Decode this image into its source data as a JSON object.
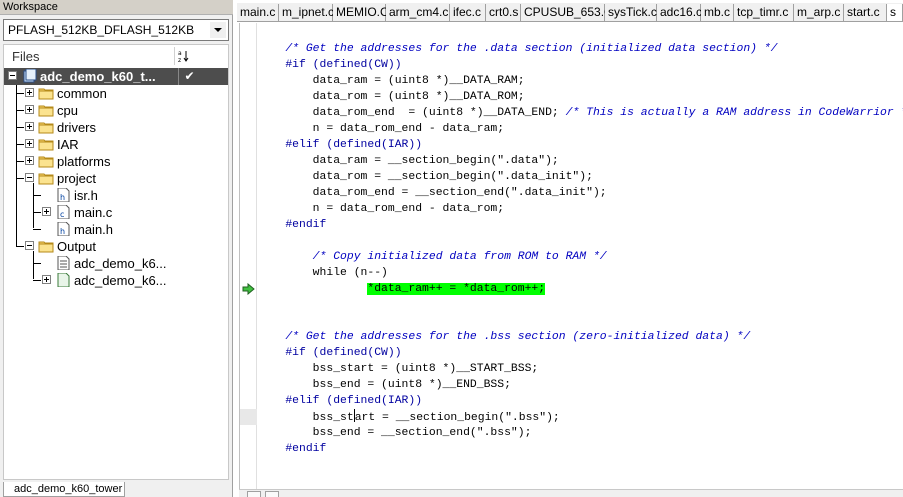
{
  "workspace": {
    "title": "Workspace",
    "configuration": "PFLASH_512KB_DFLASH_512KB",
    "files_header": "Files",
    "bottom_tab": "adc_demo_k60_tower",
    "tree": [
      {
        "label": "adc_demo_k60_t...",
        "type": "project",
        "expand": "minus",
        "checked": "✔",
        "selected": true
      },
      {
        "label": "common",
        "type": "folder",
        "expand": "plus"
      },
      {
        "label": "cpu",
        "type": "folder",
        "expand": "plus"
      },
      {
        "label": "drivers",
        "type": "folder",
        "expand": "plus"
      },
      {
        "label": "IAR",
        "type": "folder",
        "expand": "plus"
      },
      {
        "label": "platforms",
        "type": "folder",
        "expand": "plus"
      },
      {
        "label": "project",
        "type": "folder",
        "expand": "minus"
      },
      {
        "label": "isr.h",
        "type": "hfile"
      },
      {
        "label": "main.c",
        "type": "cfile",
        "expand": "plus"
      },
      {
        "label": "main.h",
        "type": "hfile"
      },
      {
        "label": "Output",
        "type": "folder",
        "expand": "minus"
      },
      {
        "label": "adc_demo_k6...",
        "type": "doc"
      },
      {
        "label": "adc_demo_k6...",
        "type": "binfile",
        "expand": "plus"
      }
    ]
  },
  "tabs": [
    "main.c",
    "m_ipnet.c",
    "MEMIO.C",
    "arm_cm4.c",
    "ifec.c",
    "crt0.s",
    "CPUSUB_653.C",
    "sysTick.c",
    "adc16.c",
    "mb.c",
    "tcp_timr.c",
    "m_arp.c",
    "start.c",
    "s"
  ],
  "active_tab_index": 13,
  "code": {
    "lines": [
      {
        "type": "comment",
        "text": "    /* Get the addresses for the .data section (initialized data section) */"
      },
      {
        "type": "preproc",
        "text": "    #if (defined(CW))"
      },
      {
        "type": "code",
        "text": "        data_ram = (uint8 *)__DATA_RAM;"
      },
      {
        "type": "code",
        "text": "        data_rom = (uint8 *)__DATA_ROM;"
      },
      {
        "type": "code_comment",
        "text": "        data_rom_end  = (uint8 *)__DATA_END; ",
        "comment": "/* This is actually a RAM address in CodeWarrior */"
      },
      {
        "type": "code",
        "text": "        n = data_rom_end - data_ram;"
      },
      {
        "type": "preproc",
        "text": "    #elif (defined(IAR))"
      },
      {
        "type": "code",
        "text": "        data_ram = __section_begin(\".data\");"
      },
      {
        "type": "code",
        "text": "        data_rom = __section_begin(\".data_init\");"
      },
      {
        "type": "code",
        "text": "        data_rom_end = __section_end(\".data_init\");"
      },
      {
        "type": "code",
        "text": "        n = data_rom_end - data_rom;"
      },
      {
        "type": "preproc",
        "text": "    #endif"
      },
      {
        "type": "blank",
        "text": ""
      },
      {
        "type": "comment",
        "text": "        /* Copy initialized data from ROM to RAM */"
      },
      {
        "type": "code",
        "text": "        while (n--)"
      },
      {
        "type": "highlight",
        "indent": "                ",
        "text": "*data_ram++ = *data_rom++;"
      },
      {
        "type": "blank",
        "text": ""
      },
      {
        "type": "blank",
        "text": ""
      },
      {
        "type": "comment",
        "text": "    /* Get the addresses for the .bss section (zero-initialized data) */"
      },
      {
        "type": "preproc",
        "text": "    #if (defined(CW))"
      },
      {
        "type": "code",
        "text": "        bss_start = (uint8 *)__START_BSS;"
      },
      {
        "type": "code",
        "text": "        bss_end = (uint8 *)__END_BSS;"
      },
      {
        "type": "preproc",
        "text": "    #elif (defined(IAR))"
      },
      {
        "type": "caret",
        "before": "        bss_st",
        "after": "art = __section_begin(\".bss\");"
      },
      {
        "type": "code",
        "text": "        bss_end = __section_end(\".bss\");"
      },
      {
        "type": "preproc",
        "text": "    #endif"
      }
    ]
  },
  "colors": {
    "highlight": "#00ff00",
    "comment": "#0000c0",
    "selection": "#4d4d4d"
  },
  "icons": {
    "combo_arrow": "chevron-down-icon",
    "sort": "sort-icon",
    "current_line": "arrow-right-icon"
  }
}
